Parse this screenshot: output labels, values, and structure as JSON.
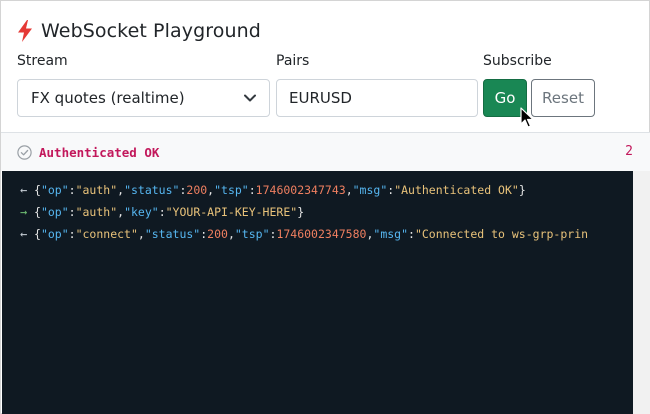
{
  "app": {
    "title": "WebSocket Playground",
    "accent": "#e53935"
  },
  "form": {
    "stream_label": "Stream",
    "stream_value": "FX quotes (realtime)",
    "pairs_label": "Pairs",
    "pairs_value": "EURUSD",
    "subscribe_label": "Subscribe",
    "go_label": "Go",
    "reset_label": "Reset",
    "go_color": "#198754"
  },
  "status": {
    "text": "Authenticated OK",
    "count": "2",
    "color": "#c2185b"
  },
  "console": {
    "background": "#0f1922",
    "messages": [
      {
        "direction": "incoming",
        "arrow": "←",
        "fields": [
          {
            "key": "\"op\"",
            "value": "\"auth\"",
            "type": "string"
          },
          {
            "key": "\"status\"",
            "value": "200",
            "type": "number"
          },
          {
            "key": "\"tsp\"",
            "value": "1746002347743",
            "type": "number"
          },
          {
            "key": "\"msg\"",
            "value": "\"Authenticated OK\"",
            "type": "string"
          }
        ]
      },
      {
        "direction": "outgoing",
        "arrow": "→",
        "fields": [
          {
            "key": "\"op\"",
            "value": "\"auth\"",
            "type": "string"
          },
          {
            "key": "\"key\"",
            "value": "\"YOUR-API-KEY-HERE\"",
            "type": "string"
          }
        ]
      },
      {
        "direction": "incoming",
        "arrow": "←",
        "fields": [
          {
            "key": "\"op\"",
            "value": "\"connect\"",
            "type": "string"
          },
          {
            "key": "\"status\"",
            "value": "200",
            "type": "number"
          },
          {
            "key": "\"tsp\"",
            "value": "1746002347580",
            "type": "number"
          },
          {
            "key": "\"msg\"",
            "value": "\"Connected to ws-grp-prin",
            "type": "string"
          }
        ]
      }
    ]
  }
}
